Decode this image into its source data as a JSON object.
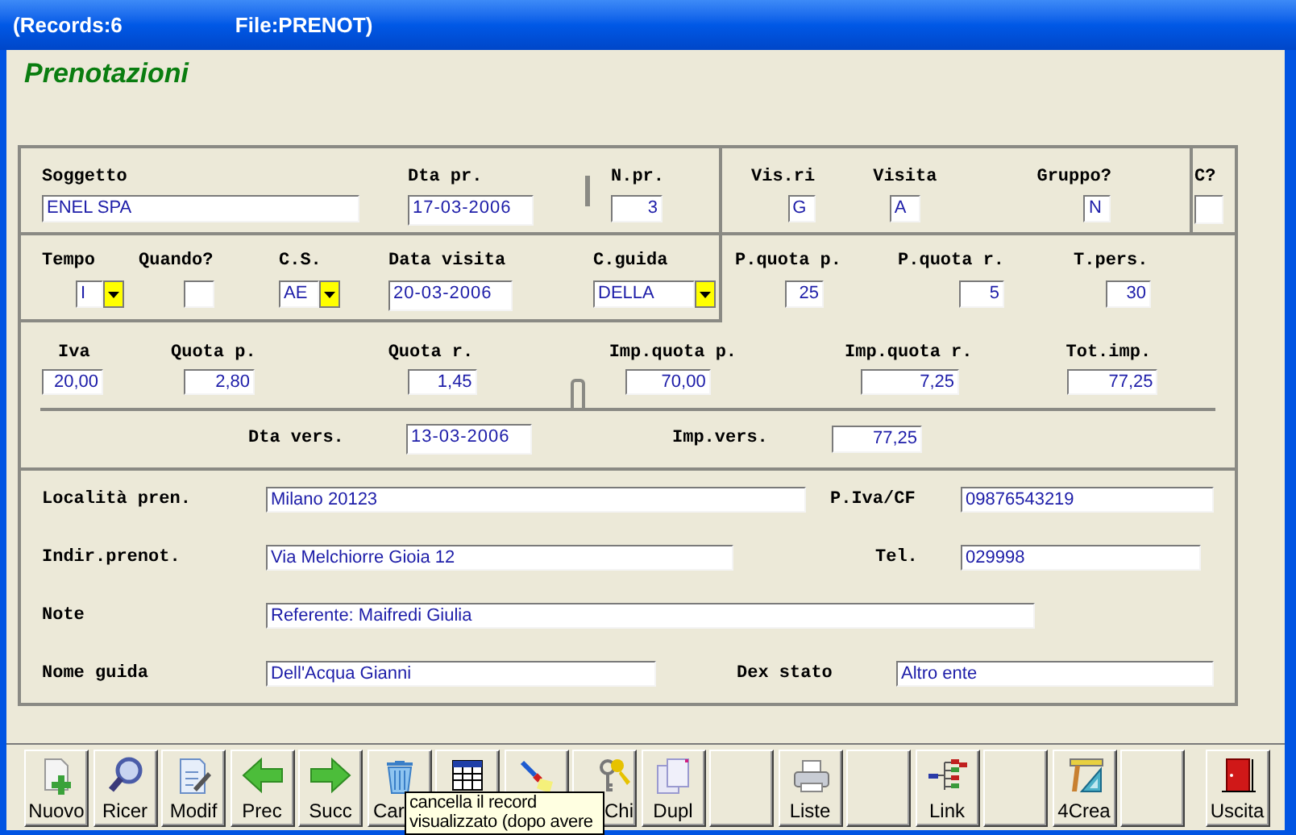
{
  "window": {
    "records": "(Records:6",
    "file": "File:PRENOT)"
  },
  "heading": "Prenotazioni",
  "fields": {
    "soggetto": {
      "label": "Soggetto",
      "value": "ENEL SPA",
      "kind": "text"
    },
    "dta_pr": {
      "label": "Dta pr.",
      "value": "17-03-2006",
      "kind": "text"
    },
    "n_pr": {
      "label": "N.pr.",
      "value": "3",
      "kind": "text"
    },
    "vis_ri": {
      "label": "Vis.ri",
      "value": "G",
      "kind": "text"
    },
    "visita": {
      "label": "Visita",
      "value": "A",
      "kind": "text"
    },
    "gruppo": {
      "label": "Gruppo?",
      "value": "N",
      "kind": "text"
    },
    "c": {
      "label": "C?",
      "kind": "text"
    },
    "tempo": {
      "label": "Tempo",
      "value": "I",
      "kind": "combo"
    },
    "quando": {
      "label": "Quando?",
      "kind": "text"
    },
    "cs": {
      "label": "C.S.",
      "value": "AE",
      "kind": "combo"
    },
    "data_visita": {
      "label": "Data visita",
      "value": "20-03-2006",
      "kind": "text"
    },
    "c_guida": {
      "label": "C.guida",
      "value": "DELLA",
      "kind": "combo"
    },
    "p_quota_p": {
      "label": "P.quota p.",
      "value": "25",
      "kind": "text"
    },
    "p_quota_r": {
      "label": "P.quota r.",
      "value": "5",
      "kind": "text"
    },
    "t_pers": {
      "label": "T.pers.",
      "value": "30",
      "kind": "text"
    },
    "iva": {
      "label": "Iva",
      "value": "20,00",
      "kind": "text"
    },
    "quota_p": {
      "label": "Quota p.",
      "value": "2,80",
      "kind": "text"
    },
    "quota_r": {
      "label": "Quota r.",
      "value": "1,45",
      "kind": "text"
    },
    "imp_quota_p": {
      "label": "Imp.quota p.",
      "value": "70,00",
      "kind": "text"
    },
    "imp_quota_r": {
      "label": "Imp.quota r.",
      "value": "7,25",
      "kind": "text"
    },
    "tot_imp": {
      "label": "Tot.imp.",
      "value": "77,25",
      "kind": "text"
    },
    "dta_vers": {
      "label": "Dta vers.",
      "value": "13-03-2006",
      "kind": "text"
    },
    "imp_vers": {
      "label": "Imp.vers.",
      "value": "77,25",
      "kind": "text"
    },
    "localita": {
      "label": "Località pren.",
      "value": "Milano 20123",
      "kind": "text"
    },
    "piva": {
      "label": "P.Iva/CF",
      "value": "09876543219",
      "kind": "text"
    },
    "indir": {
      "label": "Indir.prenot.",
      "value": "Via Melchiorre Gioia 12",
      "kind": "text"
    },
    "tel": {
      "label": "Tel.",
      "value": "029998",
      "kind": "text"
    },
    "note": {
      "label": "Note",
      "value": "Referente: Maifredi Giulia",
      "kind": "text"
    },
    "nome_guida": {
      "label": "Nome guida",
      "value": "Dell'Acqua Gianni",
      "kind": "text"
    },
    "dex_stato": {
      "label": "Dex stato",
      "value": "Altro ente",
      "kind": "text"
    }
  },
  "toolbar": [
    {
      "kind": "new",
      "label": "Nuovo"
    },
    {
      "kind": "search",
      "label": "Ricer"
    },
    {
      "kind": "edit",
      "label": "Modif"
    },
    {
      "kind": "back",
      "label": "Prec"
    },
    {
      "kind": "forward",
      "label": "Succ"
    },
    {
      "kind": "trash",
      "label": "Car"
    },
    {
      "kind": "table"
    },
    {
      "kind": "flashlight"
    },
    {
      "kind": "keys",
      "label": "Chi"
    },
    {
      "kind": "copy",
      "label": "Dupl"
    },
    {
      "kind": "blank"
    },
    {
      "kind": "print",
      "label": "Liste"
    },
    {
      "kind": "blank"
    },
    {
      "kind": "tree",
      "label": "Link"
    },
    {
      "kind": "blank"
    },
    {
      "kind": "ruler",
      "label": "4Crea"
    },
    {
      "kind": "blank"
    },
    {
      "kind": "exit",
      "label": "Uscita"
    }
  ],
  "tooltip": {
    "lines": [
      "cancella il record",
      "visualizzato (dopo avere"
    ]
  }
}
